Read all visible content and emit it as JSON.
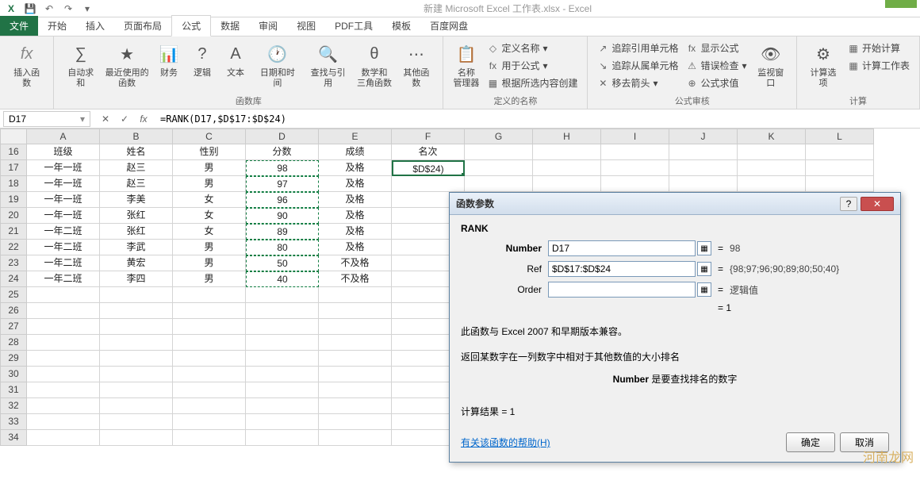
{
  "title": "新建 Microsoft Excel 工作表.xlsx - Excel",
  "qat": {
    "excel": "X",
    "save": "💾",
    "undo": "↶",
    "redo": "↷",
    "dd": "▾"
  },
  "tabs": {
    "file": "文件",
    "items": [
      "开始",
      "插入",
      "页面布局",
      "公式",
      "数据",
      "审阅",
      "视图",
      "PDF工具",
      "模板",
      "百度网盘"
    ],
    "active_index": 3
  },
  "ribbon": {
    "insert_fn": "插入函数",
    "fx": "fx",
    "lib": {
      "autosum": "自动求和",
      "recent": "最近使用的\n函数",
      "financial": "财务",
      "logical": "逻辑",
      "text": "文本",
      "datetime": "日期和时间",
      "lookup": "查找与引用",
      "math": "数学和\n三角函数",
      "more": "其他函数",
      "group": "函数库"
    },
    "names": {
      "mgr": "名称\n管理器",
      "define": "定义名称",
      "use": "用于公式",
      "create": "根据所选内容创建",
      "group": "定义的名称"
    },
    "audit": {
      "trace_p": "追踪引用单元格",
      "trace_d": "追踪从属单元格",
      "remove": "移去箭头",
      "show_f": "显示公式",
      "err": "错误检查",
      "eval": "公式求值",
      "watch": "监视窗口",
      "group": "公式审核"
    },
    "calc": {
      "options": "计算选项",
      "now": "开始计算",
      "sheet": "计算工作表",
      "group": "计算"
    }
  },
  "namebox": "D17",
  "formula": "=RANK(D17,$D$17:$D$24)",
  "columns": [
    "A",
    "B",
    "C",
    "D",
    "E",
    "F",
    "G",
    "H",
    "I",
    "J",
    "K",
    "L"
  ],
  "row_start": 16,
  "row_end": 34,
  "headers": {
    "A": "班级",
    "B": "姓名",
    "C": "性别",
    "D": "分数",
    "E": "成绩",
    "F": "名次"
  },
  "table": [
    {
      "A": "一年一班",
      "B": "赵三",
      "C": "男",
      "D": "98",
      "E": "及格",
      "F": "$D$24)"
    },
    {
      "A": "一年一班",
      "B": "赵三",
      "C": "男",
      "D": "97",
      "E": "及格",
      "F": ""
    },
    {
      "A": "一年一班",
      "B": "李美",
      "C": "女",
      "D": "96",
      "E": "及格",
      "F": ""
    },
    {
      "A": "一年一班",
      "B": "张红",
      "C": "女",
      "D": "90",
      "E": "及格",
      "F": ""
    },
    {
      "A": "一年二班",
      "B": "张红",
      "C": "女",
      "D": "89",
      "E": "及格",
      "F": ""
    },
    {
      "A": "一年二班",
      "B": "李武",
      "C": "男",
      "D": "80",
      "E": "及格",
      "F": ""
    },
    {
      "A": "一年二班",
      "B": "黄宏",
      "C": "男",
      "D": "50",
      "E": "不及格",
      "F": ""
    },
    {
      "A": "一年二班",
      "B": "李四",
      "C": "男",
      "D": "40",
      "E": "不及格",
      "F": ""
    }
  ],
  "dialog": {
    "title": "函数参数",
    "func": "RANK",
    "params": [
      {
        "label": "Number",
        "bold": true,
        "value": "D17",
        "result": "98"
      },
      {
        "label": "Ref",
        "bold": false,
        "value": "$D$17:$D$24",
        "result": "{98;97;96;90;89;80;50;40}"
      },
      {
        "label": "Order",
        "bold": false,
        "value": "",
        "result": "逻辑值"
      }
    ],
    "final_eq": "=  1",
    "desc1": "此函数与 Excel 2007 和早期版本兼容。",
    "desc2": "返回某数字在一列数字中相对于其他数值的大小排名",
    "desc3_lbl": "Number",
    "desc3_txt": "  是要查找排名的数字",
    "result_lbl": "计算结果 =  1",
    "help": "有关该函数的帮助(H)",
    "ok": "确定",
    "cancel": "取消"
  },
  "watermark": "河南龙网"
}
